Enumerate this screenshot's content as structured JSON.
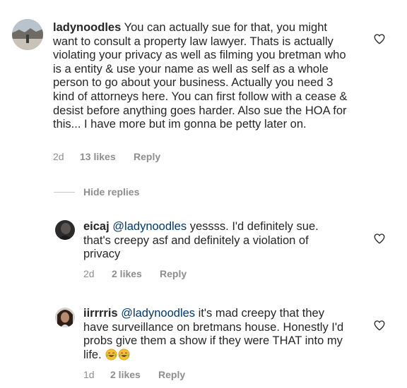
{
  "comments": [
    {
      "username": "ladynoodles",
      "text": "You can actually sue for that, you might want to consult a property law lawyer. Thats is actually violating your privacy as well as filming you bretman who is a entity & use your name as well as self as a whole person to go about your business. Actually you need 3 kind of attorneys here. You can first follow with a cease & desist before anything goes harder. Also sue the HOA for this... I have more but im gonna be petty later on.",
      "time": "2d",
      "likes": "13 likes",
      "reply": "Reply"
    }
  ],
  "hide_replies": "Hide replies",
  "replies": [
    {
      "username": "eicaj",
      "mention": "@ladynoodles",
      "text": "yessss. I'd definitely sue. that's creepy asf and definitely a violation of privacy",
      "time": "2d",
      "likes": "2 likes",
      "reply": "Reply"
    },
    {
      "username": "iirrrris",
      "mention": "@ladynoodles",
      "text": "it's mad creepy that they have surveillance on bretmans house. Honestly I'd probs give them a show if they were THAT into my life.",
      "emojis": [
        "tears-of-joy-emoji",
        "tears-of-joy-emoji"
      ],
      "time": "1d",
      "likes": "2 likes",
      "reply": "Reply"
    }
  ],
  "icons": {
    "like": "heart-outline-icon"
  },
  "colors": {
    "text": "#262626",
    "meta": "#8e8e8e",
    "mention": "#00376b",
    "divider": "#c7c7c7"
  }
}
